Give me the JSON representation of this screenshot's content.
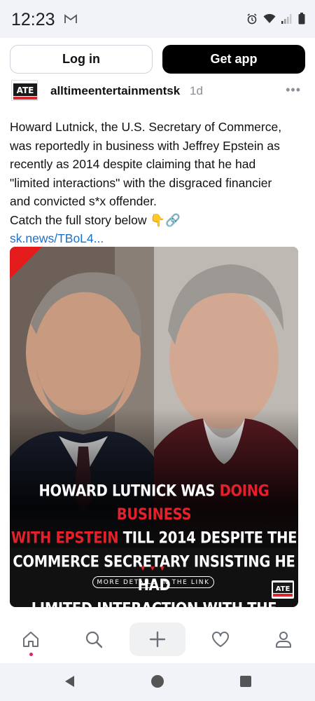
{
  "status_bar": {
    "time": "12:23",
    "icons": [
      "gmail-icon",
      "alarm-icon",
      "wifi-icon",
      "signal-icon",
      "battery-icon"
    ]
  },
  "actions": {
    "login_label": "Log in",
    "get_app_label": "Get app"
  },
  "post": {
    "avatar_text": "ATE",
    "username": "alltimeentertainmentsk",
    "timestamp": "1d",
    "more_label": "•••",
    "caption_lines": [
      "Howard Lutnick, the U.S. Secretary of Commerce,",
      "was reportedly in business with Jeffrey Epstein as",
      "recently as 2014 despite claiming that he had",
      "\"limited interactions\" with the disgraced financier",
      "and convicted s*x offender."
    ],
    "caption_cta": "Catch the full story below 👇🔗",
    "link": "sk.news/TBoL4...",
    "media": {
      "headline_l1": "HOWARD LUTNICK WAS ",
      "headline_l1_red": "DOING BUSINESS",
      "headline_l2_red": "WITH EPSTEIN",
      "headline_l2": " TILL 2014 DESPITE THE",
      "headline_l3": "COMMERCE SECRETARY INSISTING HE HAD",
      "headline_l4": "LIMITED INTERACTION WITH THE FINANCIER",
      "arrows": "▼▼▼",
      "more_details": "MORE DETAILS IN THE LINK",
      "logo_text": "ATE"
    }
  },
  "bottom_nav": {
    "items": [
      "home-icon",
      "search-icon",
      "plus-icon",
      "heart-icon",
      "profile-icon"
    ]
  },
  "system_nav": {
    "items": [
      "back-icon",
      "home-circle-icon",
      "recents-icon"
    ]
  },
  "colors": {
    "accent_red": "#e4202a",
    "link_blue": "#1d71c9",
    "status_bg": "#f1f3f8",
    "notification_dot": "#e0245e"
  }
}
